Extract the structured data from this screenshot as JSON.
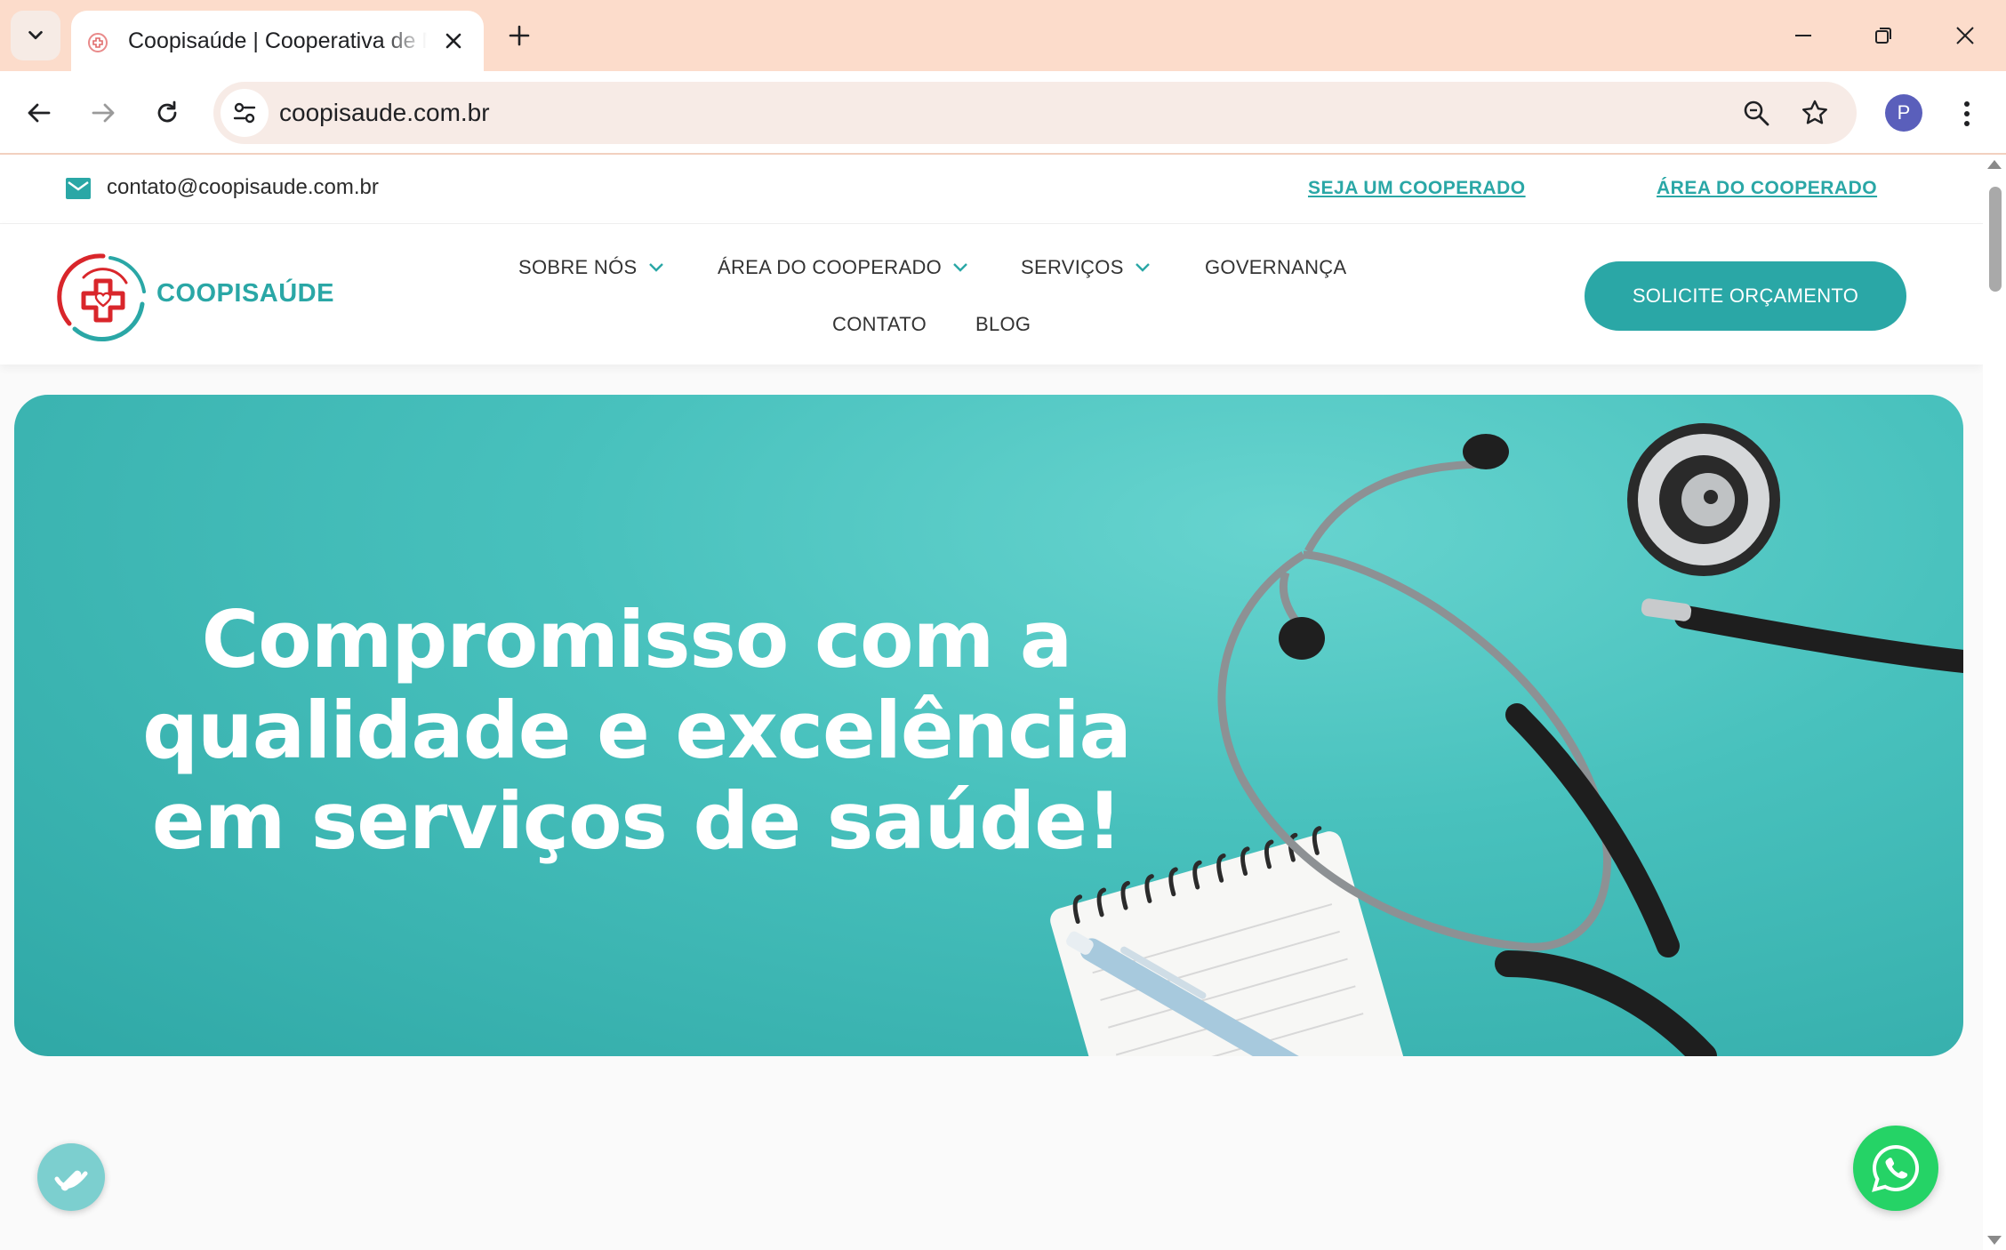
{
  "browser": {
    "tab_title": "Coopisaúde | Cooperativa de Médicos",
    "url": "coopisaude.com.br",
    "profile_initial": "P"
  },
  "topbar": {
    "email": "contato@coopisaude.com.br",
    "link_seja": "SEJA UM COOPERADO",
    "link_area": "ÁREA DO COOPERADO"
  },
  "header": {
    "logo_text": "COOPISAÚDE",
    "nav": [
      {
        "label": "SOBRE NÓS",
        "has_dropdown": true
      },
      {
        "label": "ÁREA DO COOPERADO",
        "has_dropdown": true
      },
      {
        "label": "SERVIÇOS",
        "has_dropdown": true
      },
      {
        "label": "GOVERNANÇA",
        "has_dropdown": false
      },
      {
        "label": "CONTATO",
        "has_dropdown": false
      },
      {
        "label": "BLOG",
        "has_dropdown": false
      }
    ],
    "cta": "SOLICITE ORÇAMENTO"
  },
  "hero": {
    "title": "Compromisso com a qualidade e excelência em serviços de saúde!"
  },
  "colors": {
    "accent": "#2aa7a6",
    "tabbar": "#fcdccb",
    "whatsapp": "#25d366",
    "logo_red": "#d9262b"
  },
  "icons": [
    "chevron-down-icon",
    "close-icon",
    "plus-icon",
    "minimize-icon",
    "restore-icon",
    "back-icon",
    "forward-icon",
    "reload-icon",
    "site-settings-icon",
    "zoom-icon",
    "star-icon",
    "more-icon",
    "mail-icon",
    "accessibility-icon",
    "whatsapp-icon"
  ]
}
